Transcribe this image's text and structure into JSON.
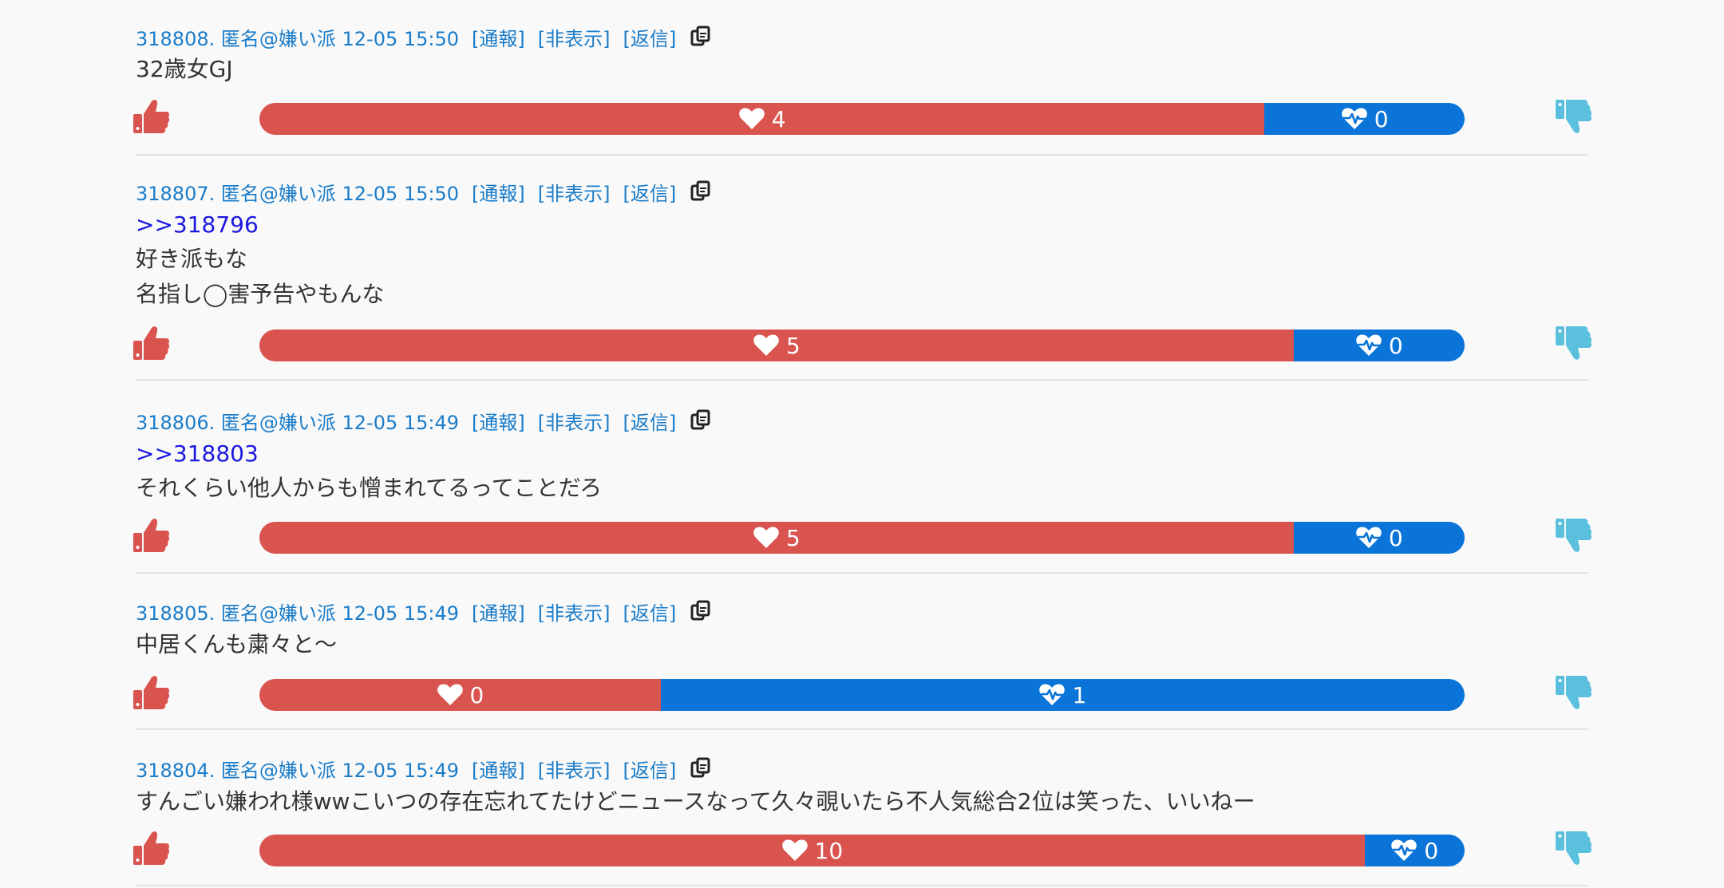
{
  "colors": {
    "link": "#1a7cc9",
    "anchor": "#1c18e0",
    "text": "#333333",
    "good_bar": "#d9534f",
    "bad_bar": "#0a74d9",
    "thumb_up": "#d9534f",
    "thumb_down": "#5bc0de"
  },
  "labels": {
    "report": "[通報]",
    "hide": "[非表示]",
    "reply": "[返信]"
  },
  "icons": {
    "copy": "copy-icon",
    "thumb_up": "thumbs-up-icon",
    "thumb_down": "thumbs-down-icon",
    "good": "heart-icon",
    "bad": "heartbeat-icon"
  },
  "posts": [
    {
      "meta": "318808. 匿名@嫌い派 12-05 15:50",
      "lines": [
        {
          "text": "32歳女GJ",
          "type": "text"
        }
      ],
      "good": 4,
      "bad": 0,
      "good_share": 0.834
    },
    {
      "meta": "318807. 匿名@嫌い派 12-05 15:50",
      "lines": [
        {
          "text": ">>318796",
          "type": "anchor"
        },
        {
          "text": "好き派もな",
          "type": "text"
        },
        {
          "text": "名指し◯害予告やもんな",
          "type": "text"
        }
      ],
      "good": 5,
      "bad": 0,
      "good_share": 0.858
    },
    {
      "meta": "318806. 匿名@嫌い派 12-05 15:49",
      "lines": [
        {
          "text": ">>318803",
          "type": "anchor"
        },
        {
          "text": "それくらい他人からも憎まれてるってことだろ",
          "type": "text"
        }
      ],
      "good": 5,
      "bad": 0,
      "good_share": 0.858
    },
    {
      "meta": "318805. 匿名@嫌い派 12-05 15:49",
      "lines": [
        {
          "text": "中居くんも粛々と〜",
          "type": "text"
        }
      ],
      "good": 0,
      "bad": 1,
      "good_share": 0.333
    },
    {
      "meta": "318804. 匿名@嫌い派 12-05 15:49",
      "lines": [
        {
          "text": "すんごい嫌われ様wwこいつの存在忘れてたけどニュースなって久々覗いたら不人気総合2位は笑った、いいねー",
          "type": "text"
        }
      ],
      "good": 10,
      "bad": 0,
      "good_share": 0.917
    }
  ]
}
